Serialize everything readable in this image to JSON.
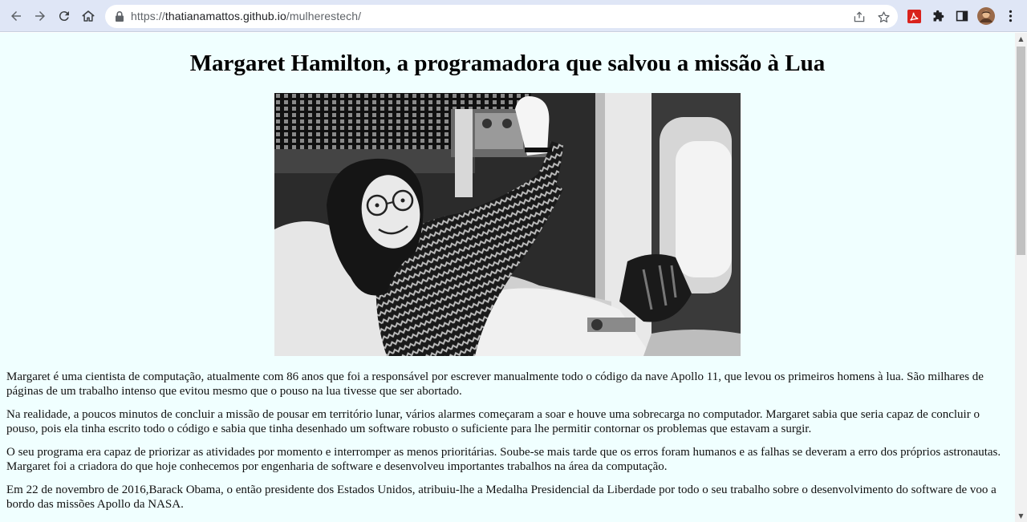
{
  "browser": {
    "url_scheme": "https://",
    "url_host": "thatianamattos.github.io",
    "url_path": "/mulherestech/"
  },
  "icons": {
    "back": "arrow-left-icon",
    "forward": "arrow-right-icon",
    "reload": "reload-icon",
    "home": "home-icon",
    "lock": "lock-icon",
    "share": "share-icon",
    "bookmark": "star-icon",
    "pdf_extension": "pdf-extension-icon",
    "extensions": "puzzle-icon",
    "side_panel": "side-panel-icon",
    "profile": "avatar-icon",
    "menu": "kebab-menu-icon"
  },
  "colors": {
    "page_background": "#f0ffff",
    "toolbar_background": "#dfe6f6",
    "pdf_red": "#d9221c"
  },
  "article": {
    "title": "Margaret Hamilton, a programadora que salvou a missão à Lua",
    "paragraphs": [
      "Margaret é uma cientista de computação, atualmente com 86 anos que foi a responsável por escrever manualmente todo o código da nave Apollo 11, que levou os primeiros homens à lua. São milhares de páginas de um trabalho intenso que evitou mesmo que o pouso na lua tivesse que ser abortado.",
      "Na realidade, a poucos minutos de concluir a missão de pousar em território lunar, vários alarmes começaram a soar e houve uma sobrecarga no computador. Margaret sabia que seria capaz de concluir o pouso, pois ela tinha escrito todo o código e sabia que tinha desenhado um software robusto o suficiente para lhe permitir contornar os problemas que estavam a surgir.",
      "O seu programa era capaz de priorizar as atividades por momento e interromper as menos prioritárias. Soube-se mais tarde que os erros foram humanos e as falhas se deveram a erro dos próprios astronautas. Margaret foi a criadora do que hoje conhecemos por engenharia de software e desenvolveu importantes trabalhos na área da computação.",
      "Em 22 de novembro de 2016,Barack Obama, o então presidente dos Estados Unidos, atribuiu-lhe a Medalha Presidencial da Liberdade por todo o seu trabalho sobre o desenvolvimento do software de voo a bordo das missões Apollo da NASA."
    ]
  }
}
